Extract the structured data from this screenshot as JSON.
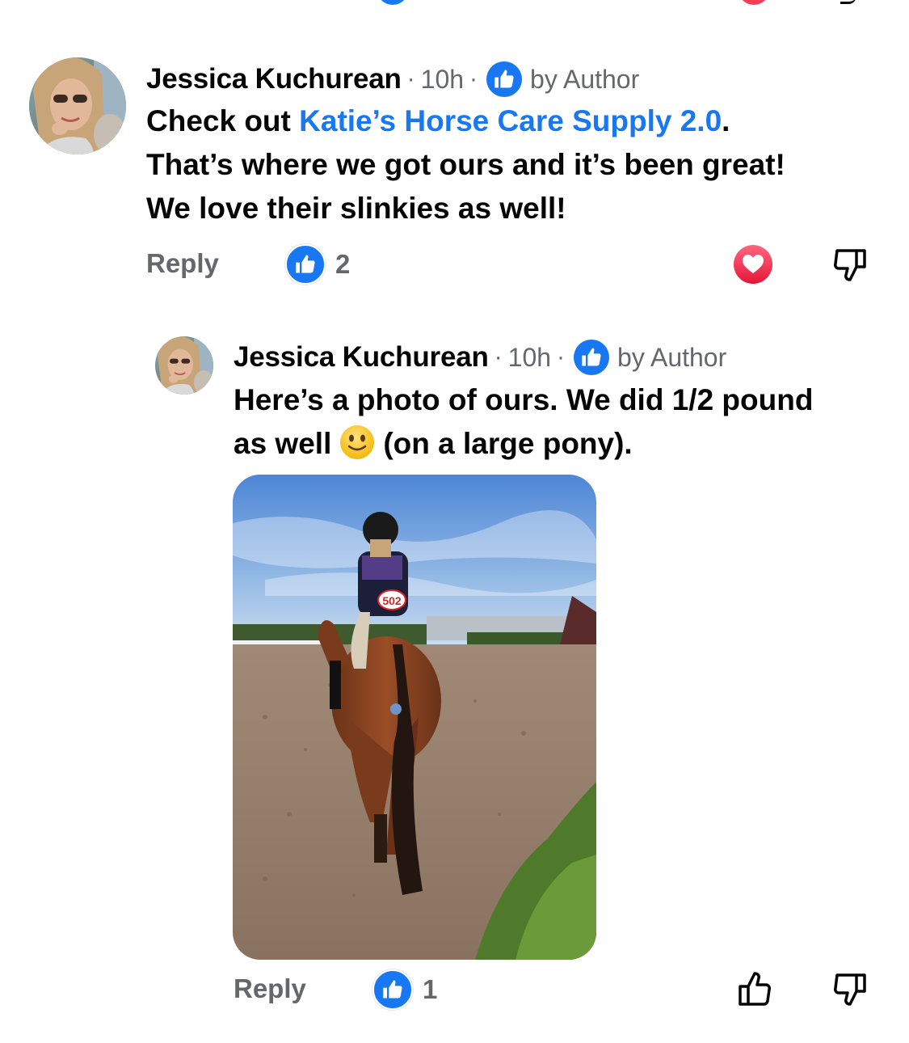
{
  "colors": {
    "brand_blue": "#1877f2",
    "secondary_text": "#65676b",
    "primary_text": "#050505",
    "love_red": "#f33e58"
  },
  "comment": {
    "author": "Jessica Kuchurean",
    "time": "10h",
    "badge_icon": "thumbs-up-icon",
    "badge_label": "by Author",
    "text_prefix": "Check out ",
    "link_text": "Katie’s Horse Care Supply 2.0",
    "text_suffix": ".",
    "text_line2": "That’s where we got ours and it’s been great!",
    "text_line3": "We love their slinkies as well!",
    "reply_label": "Reply",
    "like_count": "2",
    "reaction_icon": "heart-reaction-icon",
    "dislike_icon": "thumbs-down-icon"
  },
  "reply": {
    "author": "Jessica Kuchurean",
    "time": "10h",
    "badge_icon": "thumbs-up-icon",
    "badge_label": "by Author",
    "text_line1": "Here’s a photo of ours. We did 1/2 pound",
    "text_line2_start": "as well",
    "emoji": "slightly-smiling-face-emoji",
    "text_line2_end": "(on a large pony).",
    "photo_number": "502",
    "reply_label": "Reply",
    "like_count": "1",
    "like_icon": "thumbs-up-outline-icon",
    "dislike_icon": "thumbs-down-icon"
  }
}
